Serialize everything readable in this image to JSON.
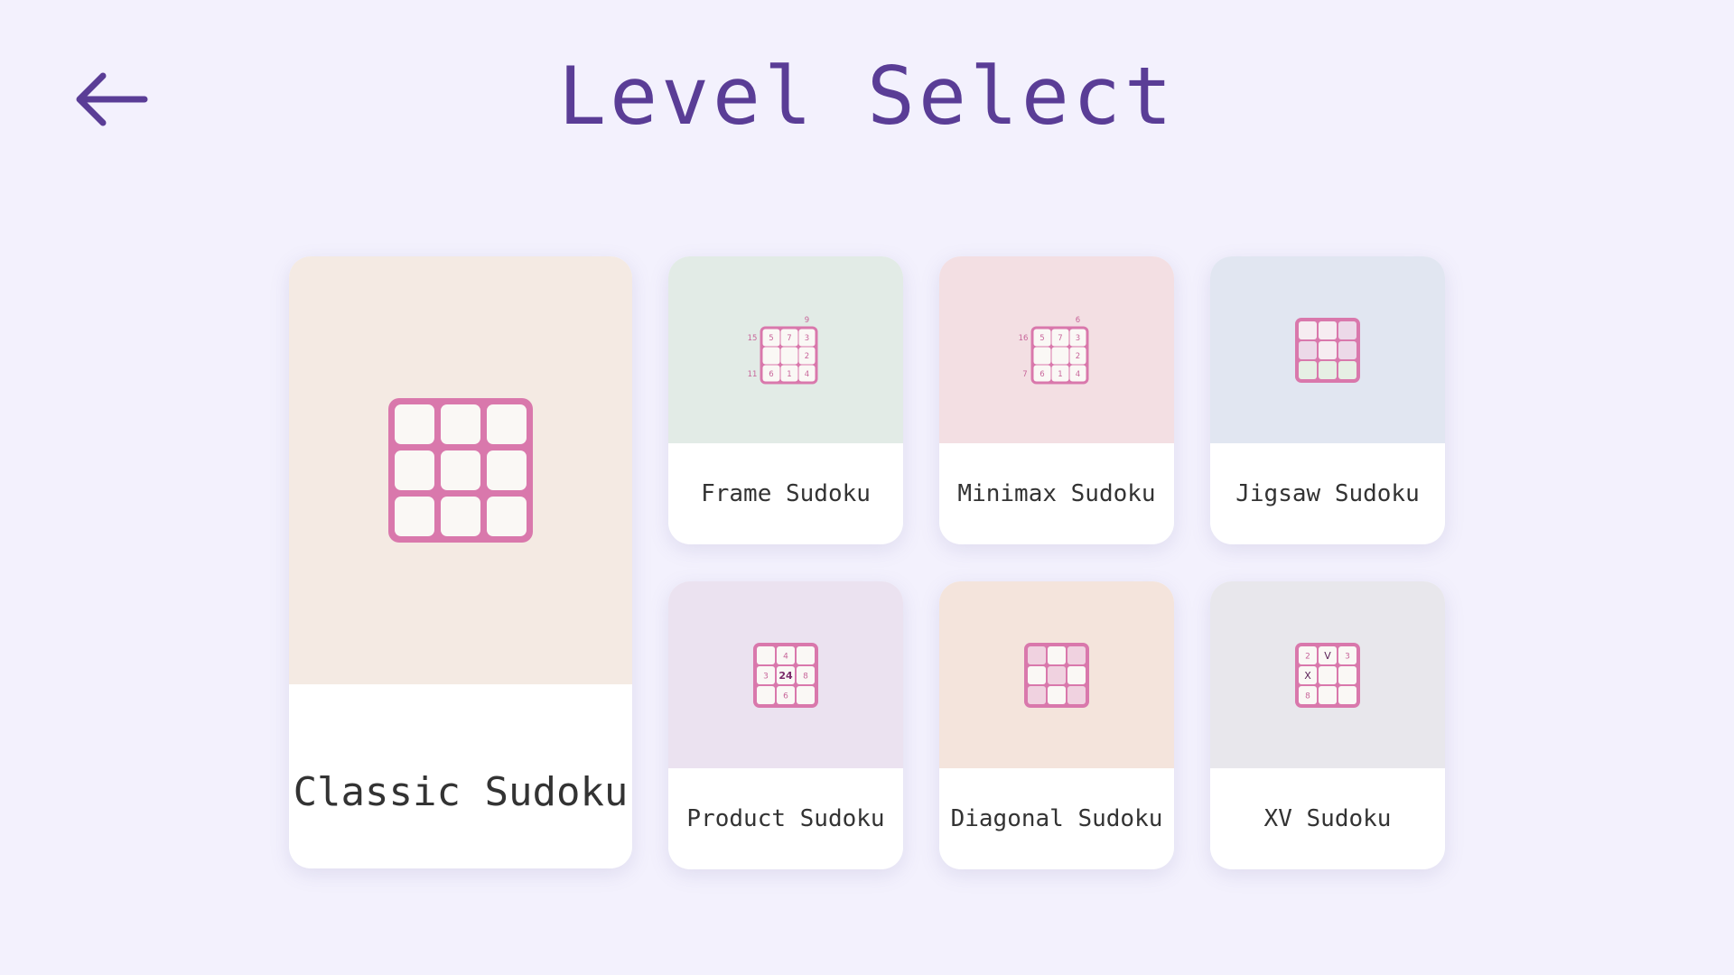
{
  "header": {
    "title": "Level Select",
    "back_icon": "arrow-left-icon"
  },
  "colors": {
    "background": "#f3f1fd",
    "title": "#5a3d96",
    "grid_stroke": "#d978ac",
    "cell_fill": "#faf8f5",
    "clue_text": "#c7659a"
  },
  "levels": [
    {
      "label": "Classic Sudoku",
      "art_bg": "#f4eae3",
      "icon": "grid-icon"
    },
    {
      "label": "Frame Sudoku",
      "art_bg": "#e2ebe6",
      "icon": "frame-grid-icon",
      "cells": [
        [
          "5",
          "7",
          "3"
        ],
        [
          "",
          "",
          "2"
        ],
        [
          "6",
          "1",
          "4"
        ]
      ],
      "left_clues": [
        "15",
        "",
        "11"
      ],
      "top_clues": [
        "",
        "",
        "9"
      ]
    },
    {
      "label": "Minimax Sudoku",
      "art_bg": "#f3dfe3",
      "icon": "minimax-grid-icon",
      "cells": [
        [
          "5",
          "7",
          "3"
        ],
        [
          "",
          "",
          "2"
        ],
        [
          "6",
          "1",
          "4"
        ]
      ],
      "left_clues": [
        "16",
        "",
        "7"
      ],
      "top_clues": [
        "",
        "",
        "6"
      ]
    },
    {
      "label": "Jigsaw Sudoku",
      "art_bg": "#e1e6f1",
      "icon": "jigsaw-grid-icon"
    },
    {
      "label": "Product Sudoku",
      "art_bg": "#ebe2f0",
      "icon": "product-grid-icon",
      "cells": [
        [
          "",
          "4",
          ""
        ],
        [
          "3",
          "24",
          "8"
        ],
        [
          "",
          "6",
          ""
        ]
      ]
    },
    {
      "label": "Diagonal Sudoku",
      "art_bg": "#f4e4dc",
      "icon": "diagonal-grid-icon"
    },
    {
      "label": "XV Sudoku",
      "art_bg": "#e8e7ec",
      "icon": "xv-grid-icon",
      "cells": [
        [
          "2",
          "V",
          "3"
        ],
        [
          "X",
          "",
          ""
        ],
        [
          "8",
          "",
          ""
        ]
      ]
    }
  ]
}
